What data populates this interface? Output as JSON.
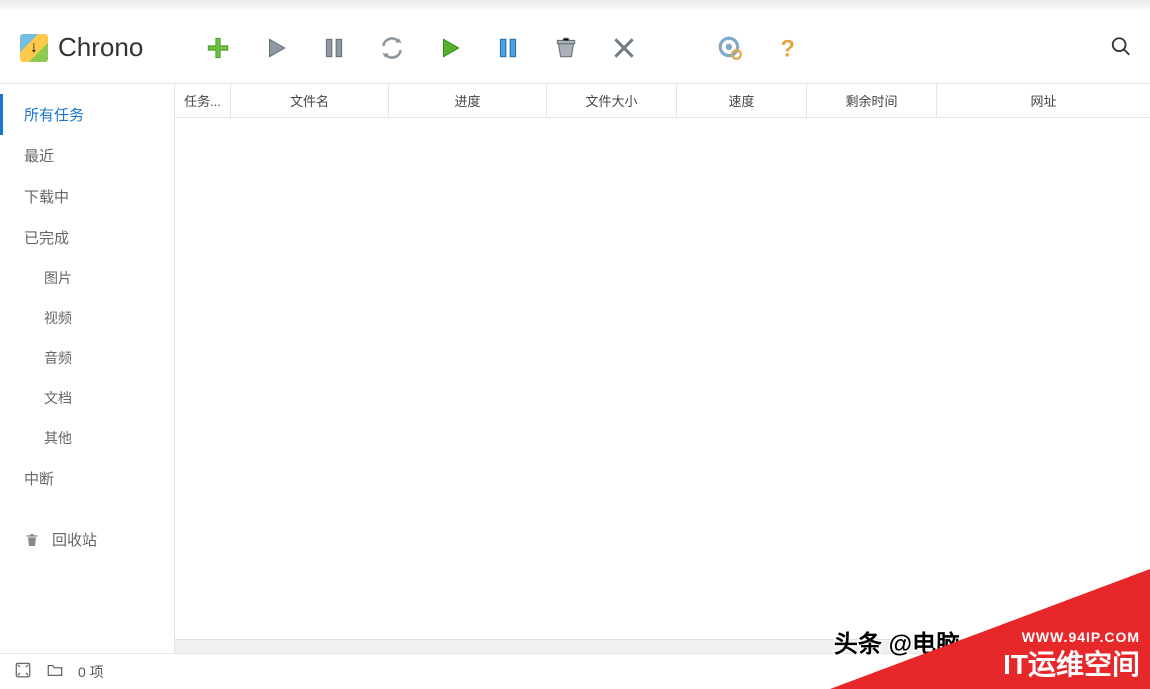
{
  "app": {
    "name": "Chrono"
  },
  "toolbar": {
    "add": "新建",
    "start": "开始",
    "pause": "暂停",
    "refresh": "刷新",
    "start_all": "全部开始",
    "pause_all": "全部暂停",
    "remove": "移除",
    "delete": "删除",
    "settings": "设置",
    "help": "帮助",
    "search": "搜索"
  },
  "sidebar": {
    "all": "所有任务",
    "recent": "最近",
    "downloading": "下载中",
    "completed": "已完成",
    "images": "图片",
    "videos": "视频",
    "audio": "音频",
    "docs": "文档",
    "other": "其他",
    "interrupted": "中断",
    "trash": "回收站"
  },
  "columns": {
    "task": "任务...",
    "filename": "文件名",
    "progress": "进度",
    "size": "文件大小",
    "speed": "速度",
    "remaining": "剩余时间",
    "url": "网址"
  },
  "status": {
    "items": "0 项"
  },
  "watermark": {
    "prefix": "头条 @电脑",
    "site": "WWW.94IP.COM",
    "brand": "IT运维空间"
  }
}
